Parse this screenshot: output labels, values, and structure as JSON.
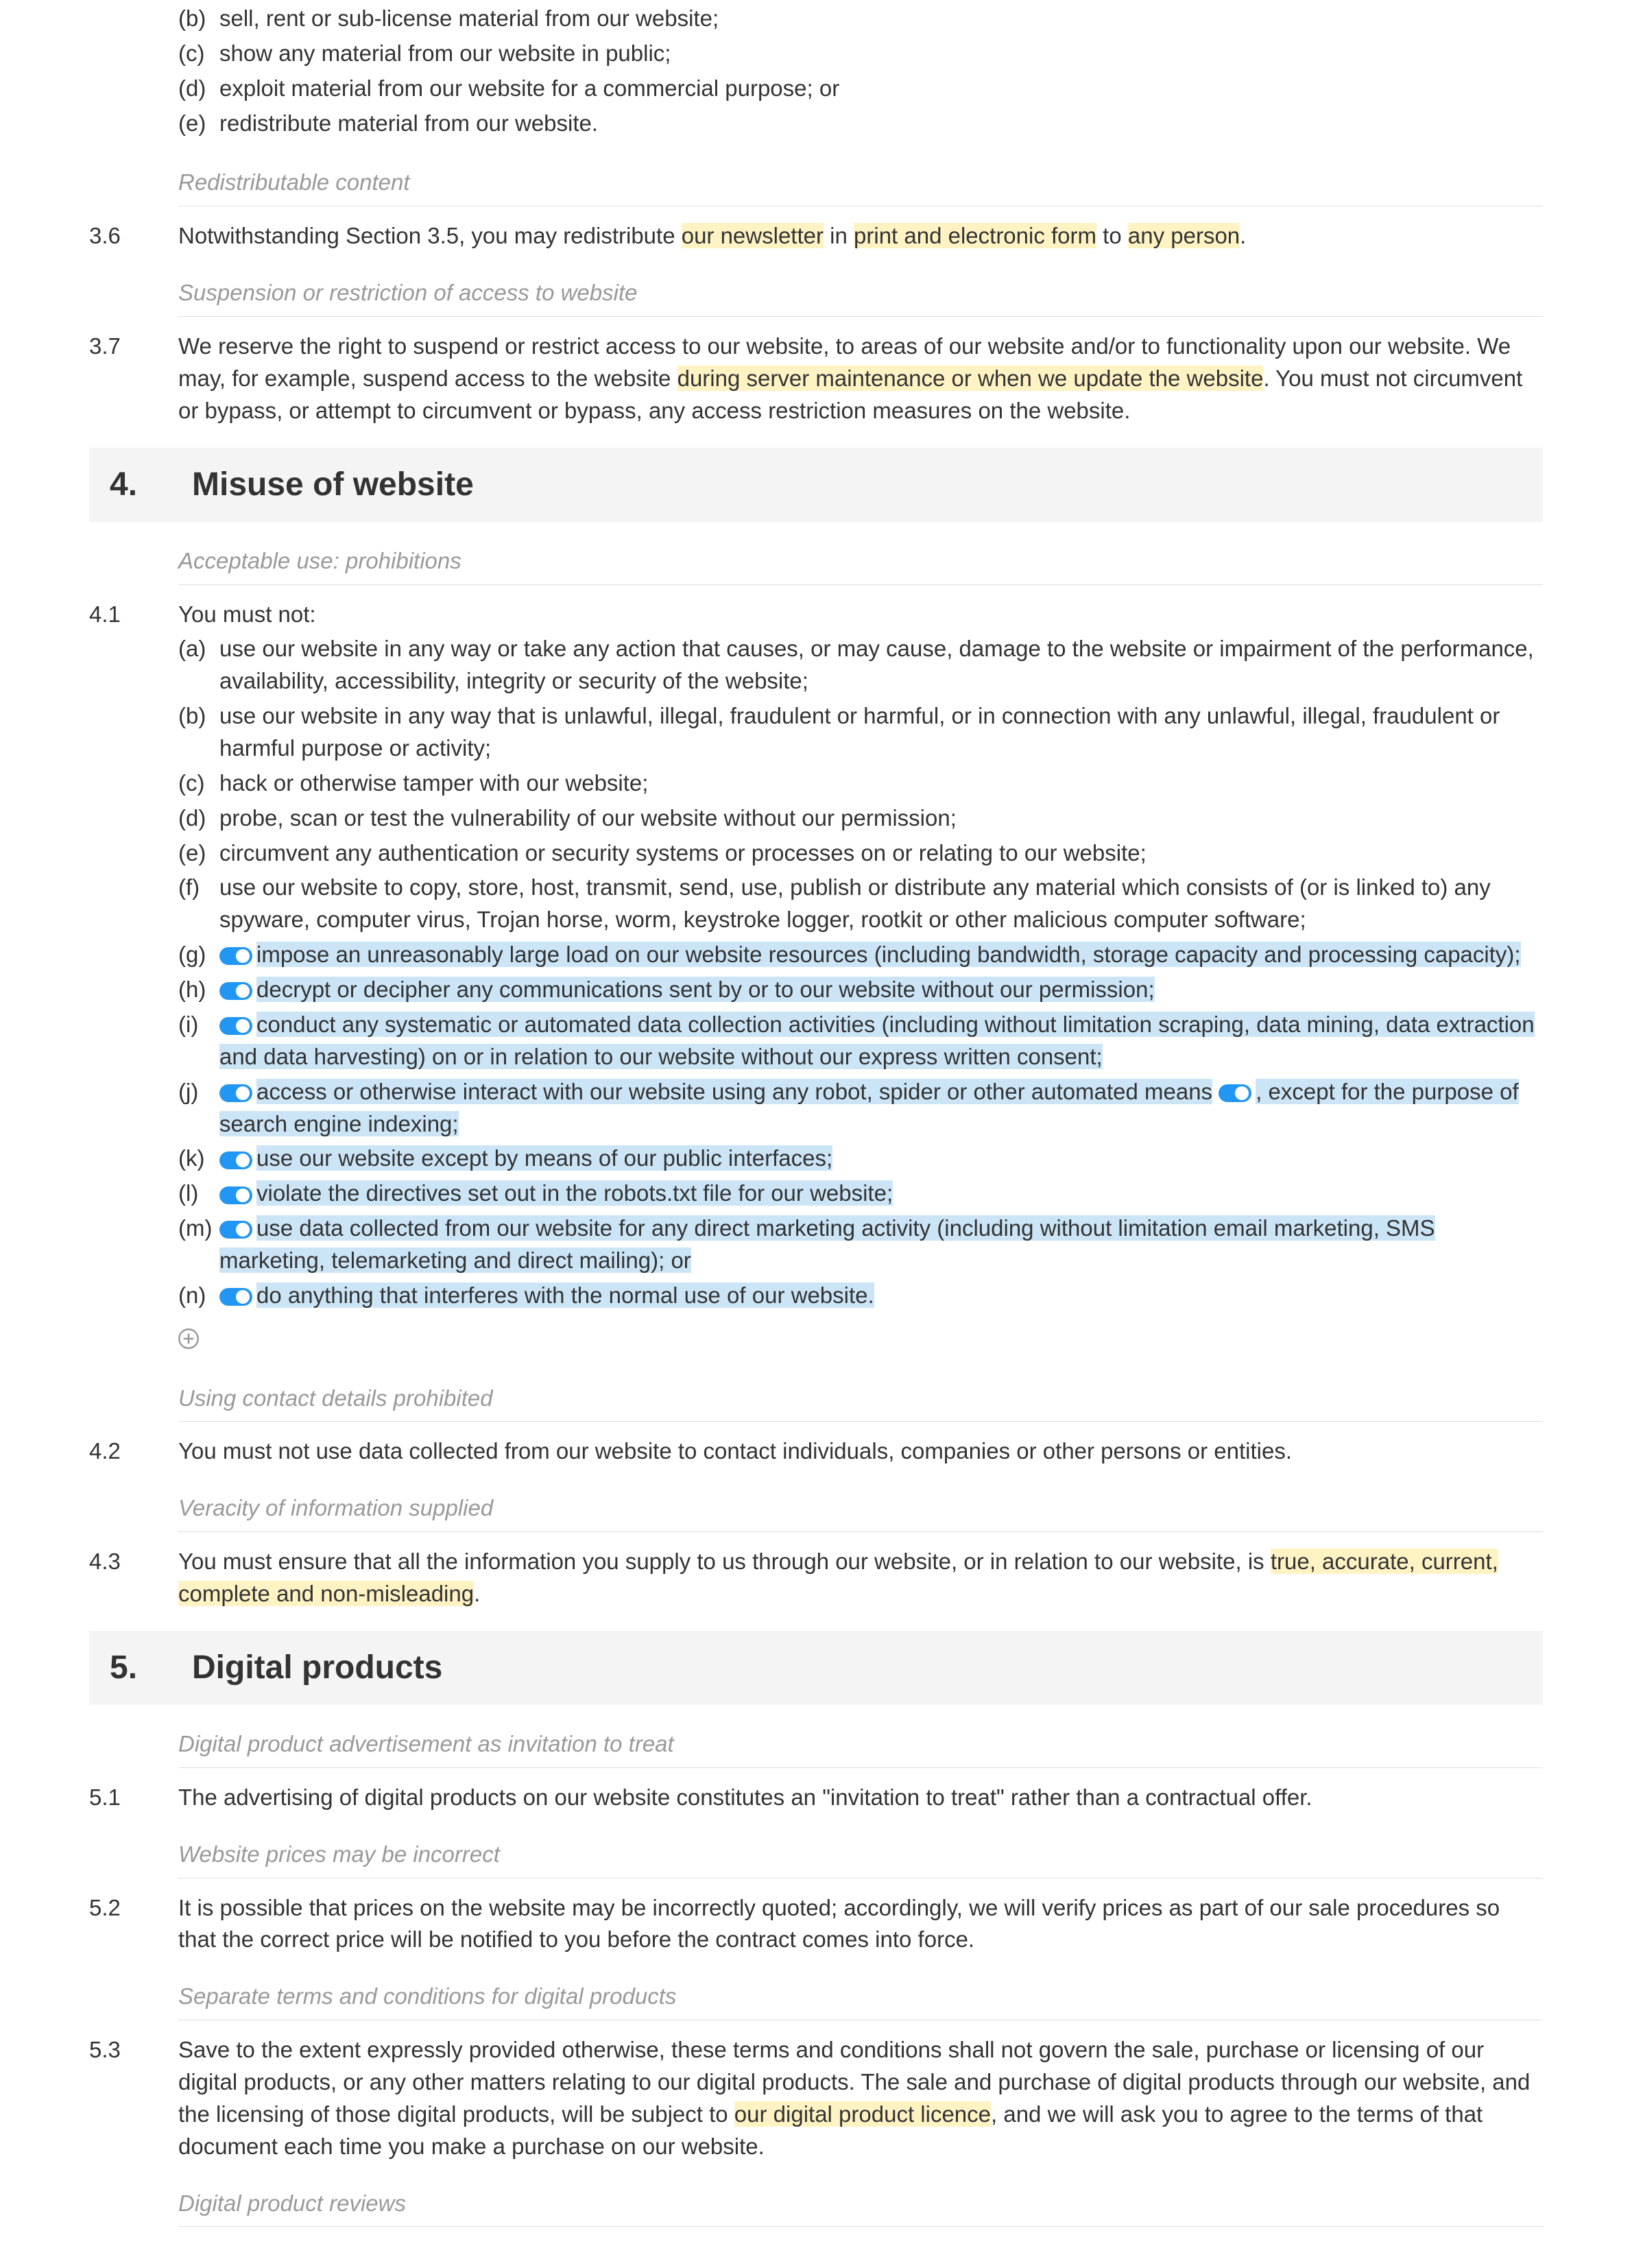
{
  "clauses35": {
    "items": [
      {
        "m": "(b)",
        "t": "sell, rent or sub-license material from our website;"
      },
      {
        "m": "(c)",
        "t": "show any material from our website in public;"
      },
      {
        "m": "(d)",
        "t": "exploit material from our website for a commercial purpose; or"
      },
      {
        "m": "(e)",
        "t": "redistribute material from our website."
      }
    ]
  },
  "anno36": "Redistributable content",
  "c36num": "3.6",
  "c36a": "Notwithstanding Section 3.5, you may redistribute ",
  "c36b": "our newsletter",
  "c36c": " in ",
  "c36d": "print and electronic form",
  "c36e": " to ",
  "c36f": "any person",
  "c36g": ".",
  "anno37": "Suspension or restriction of access to website",
  "c37num": "3.7",
  "c37a": "We reserve the right to suspend or restrict access to our website, to areas of our website and/or to functionality upon our website. We may, for example, suspend access to the website ",
  "c37b": "during server maintenance or when we update the website",
  "c37c": ". You must not circumvent or bypass, or attempt to circumvent or bypass, any access restriction measures on the website.",
  "sec4num": "4.",
  "sec4title": "Misuse of website",
  "anno41": "Acceptable use: prohibitions",
  "c41num": "4.1",
  "c41intro": "You must not:",
  "c41": {
    "a": {
      "m": "(a)",
      "t": "use our website in any way or take any action that causes, or may cause, damage to the website or impairment of the performance, availability, accessibility, integrity or security of the website;"
    },
    "b": {
      "m": "(b)",
      "t": "use our website in any way that is unlawful, illegal, fraudulent or harmful, or in connection with any unlawful, illegal, fraudulent or harmful purpose or activity;"
    },
    "c": {
      "m": "(c)",
      "t": "hack or otherwise tamper with our website;"
    },
    "d": {
      "m": "(d)",
      "t": "probe, scan or test the vulnerability of our website without our permission;"
    },
    "e": {
      "m": "(e)",
      "t": "circumvent any authentication or security systems or processes on or relating to our website;"
    },
    "f": {
      "m": "(f)",
      "t": "use our website to copy, store, host, transmit, send, use, publish or distribute any material which consists of (or is linked to) any spyware, computer virus, Trojan horse, worm, keystroke logger, rootkit or other malicious computer software;"
    },
    "g": {
      "m": "(g)",
      "t": "impose an unreasonably large load on our website resources (including bandwidth, storage capacity and processing capacity);"
    },
    "h": {
      "m": "(h)",
      "t": "decrypt or decipher any communications sent by or to our website without our permission;"
    },
    "i": {
      "m": "(i)",
      "t": "conduct any systematic or automated data collection activities (including without limitation scraping, data mining, data extraction and data harvesting) on or in relation to our website without our express written consent;"
    },
    "j": {
      "m": "(j)",
      "t1": "access or otherwise interact with our website using any robot, spider or other automated means",
      "t2": ", except for the purpose of search engine indexing",
      "t3": ";"
    },
    "k": {
      "m": "(k)",
      "t": "use our website except by means of our public interfaces;"
    },
    "l": {
      "m": "(l)",
      "t": "violate the directives set out in the robots.txt file for our website;"
    },
    "m": {
      "m": "(m)",
      "t": "use data collected from our website for any direct marketing activity (including without limitation email marketing, SMS marketing, telemarketing and direct mailing); or"
    },
    "n": {
      "m": "(n)",
      "t": "do anything that interferes with the normal use of our website."
    }
  },
  "anno42": "Using contact details prohibited",
  "c42num": "4.2",
  "c42": "You must not use data collected from our website to contact individuals, companies or other persons or entities.",
  "anno43": "Veracity of information supplied",
  "c43num": "4.3",
  "c43a": "You must ensure that all the information you supply to us through our website, or in relation to our website, is ",
  "c43b": "true, accurate, current, complete and non-misleading",
  "c43c": ".",
  "sec5num": "5.",
  "sec5title": "Digital products",
  "anno51": "Digital product advertisement as invitation to treat",
  "c51num": "5.1",
  "c51": "The advertising of digital products on our website constitutes an \"invitation to treat\" rather than a contractual offer.",
  "anno52": "Website prices may be incorrect",
  "c52num": "5.2",
  "c52": "It is possible that prices on the website may be incorrectly quoted; accordingly, we will verify prices as part of our sale procedures so that the correct price will be notified to you before the contract comes into force.",
  "anno53": "Separate terms and conditions for digital products",
  "c53num": "5.3",
  "c53a": "Save to the extent expressly provided otherwise, these terms and conditions shall not govern the sale, purchase or licensing of our digital products, or any other matters relating to our digital products. The sale and purchase of digital products through our website, and the licensing of those digital products, will be subject to ",
  "c53b": "our digital product licence",
  "c53c": ", and we will ask you to agree to the terms of that document each time you make a purchase on our website.",
  "anno54": "Digital product reviews"
}
